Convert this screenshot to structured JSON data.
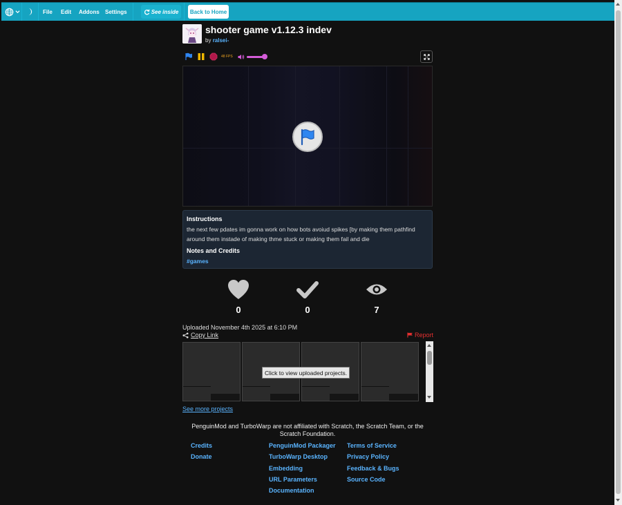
{
  "menubar": {
    "globe_icon": "globe-icon",
    "theme_icon": "moon-icon",
    "file": "File",
    "edit": "Edit",
    "addons": "Addons",
    "settings": "Settings",
    "see_inside": "See inside",
    "back_to_home": "Back to Home",
    "accent_color": "#16a4c1"
  },
  "project": {
    "title": "shooter game v1.12.3 indev",
    "by": "by",
    "author": "ralsei-"
  },
  "controls": {
    "fps": "48 FPS",
    "volume": 0.8
  },
  "instructions": {
    "heading": "Instructions",
    "text": "the next few pdates im gonna work on how bots avoiud spikes [by making them pathfind around them instade of making thme stuck or making them fail and die",
    "notes_heading": "Notes and Credits",
    "notes_text": "#games"
  },
  "stats": {
    "loves": "0",
    "favorites": "0",
    "views": "7"
  },
  "meta": {
    "uploaded": "Uploaded November 4th 2025 at 6:10 PM",
    "copy_link": "Copy Link",
    "report": "Report"
  },
  "uploaded_projects": {
    "button": "Click to view uploaded projects."
  },
  "see_more": "See more projects",
  "footer": {
    "disclaimer": "PenguinMod and TurboWarp are not affiliated with Scratch, the Scratch Team, or the Scratch Foundation.",
    "col1": [
      "Credits",
      "Donate"
    ],
    "col2": [
      "PenguinMod Packager",
      "TurboWarp Desktop",
      "Embedding",
      "URL Parameters",
      "Documentation"
    ],
    "col3": [
      "Terms of Service",
      "Privacy Policy",
      "Feedback & Bugs",
      "Source Code"
    ]
  }
}
